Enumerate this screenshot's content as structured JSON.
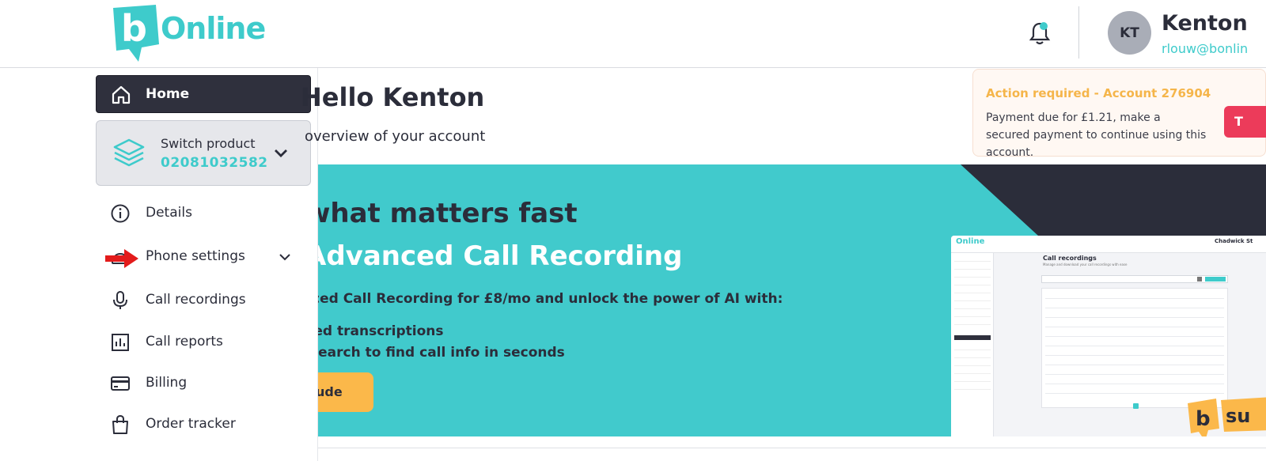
{
  "header": {
    "logo_text": "Online",
    "logo_letter": "b",
    "user_initials": "KT",
    "user_name": "Kenton",
    "user_email": "rlouw@bonlin"
  },
  "sidebar": {
    "home": "Home",
    "switch_product": {
      "title": "Switch product",
      "number": "02081032582"
    },
    "items": [
      {
        "label": "Details",
        "icon": "info-icon"
      },
      {
        "label": "Phone settings",
        "icon": "phone-settings-icon"
      },
      {
        "label": "Call recordings",
        "icon": "microphone-icon"
      },
      {
        "label": "Call reports",
        "icon": "chart-icon"
      },
      {
        "label": "Billing",
        "icon": "credit-card-icon"
      },
      {
        "label": "Order tracker",
        "icon": "shopping-bag-icon"
      }
    ]
  },
  "main": {
    "greeting": "Hello Kenton",
    "sub_greeting": "overview of your account"
  },
  "alert": {
    "title": "Action required - Account 276904",
    "body": "Payment due for £1.21, make a secured payment to continue using this account.",
    "button": "T"
  },
  "banner": {
    "heading1": "what matters fast",
    "heading2": "Advanced Call Recording",
    "paragraph": "ced Call Recording for £8/mo and unlock the power of AI with:",
    "bullet1": "red transcriptions",
    "bullet2": " search to find call info in seconds",
    "cta": "ude",
    "mini": {
      "logo": "Online",
      "user": "Chadwick St",
      "title": "Call recordings",
      "subtitle": "Manage and download your call recordings with ease"
    },
    "sup_badge": "b su"
  },
  "colors": {
    "brand_teal": "#41cacc",
    "dark": "#2f303d",
    "alert_orange": "#f5b54a",
    "cta_yellow": "#fbb84a",
    "alert_red": "#ec3b5a"
  }
}
